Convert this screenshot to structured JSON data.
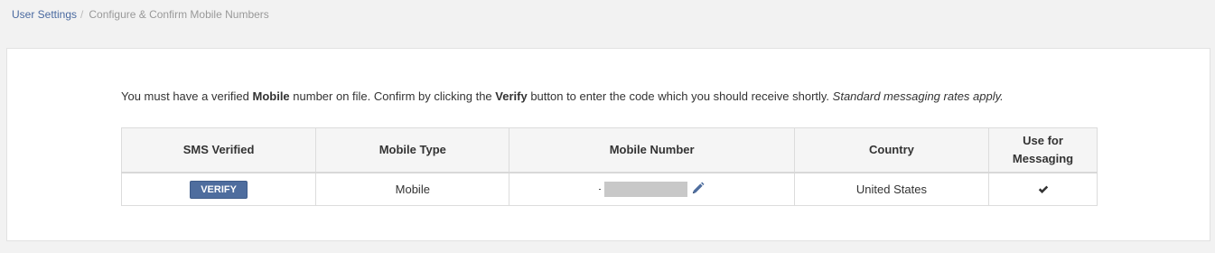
{
  "breadcrumb": {
    "parent": "User Settings",
    "separator": "/",
    "current": "Configure & Confirm Mobile Numbers"
  },
  "notice": {
    "part1": "You must have a verified ",
    "bold1": "Mobile",
    "part2": " number on file. Confirm by clicking the ",
    "bold2": "Verify",
    "part3": " button to enter the code which you should receive shortly. ",
    "italic": "Standard messaging rates apply."
  },
  "table": {
    "headers": {
      "sms_verified": "SMS Verified",
      "mobile_type": "Mobile Type",
      "mobile_number": "Mobile Number",
      "country": "Country",
      "use_for_messaging": "Use for Messaging"
    },
    "rows": [
      {
        "verify_label": "VERIFY",
        "mobile_type": "Mobile",
        "mobile_number": "",
        "country": "United States",
        "use_for_messaging": true
      }
    ]
  },
  "icons": {
    "edit": "pencil-icon",
    "check": "checkmark-icon"
  },
  "colors": {
    "accent_button": "#4e6d9e",
    "link": "#4a6aa0"
  }
}
